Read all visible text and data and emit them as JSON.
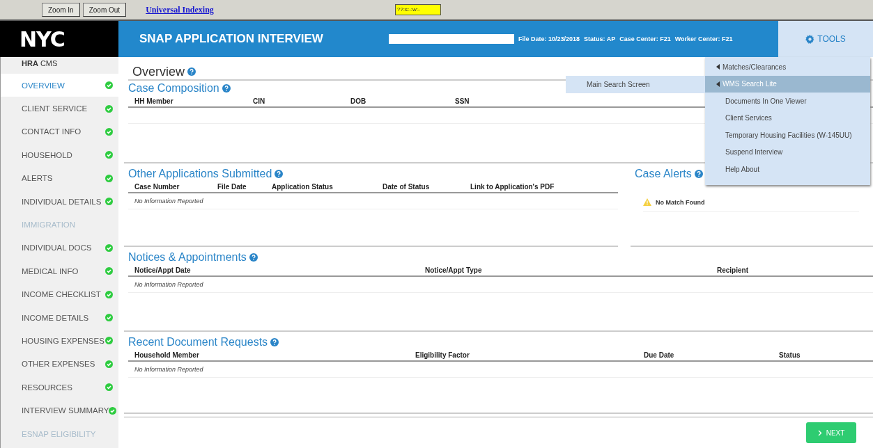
{
  "toolbar": {
    "buttons": [
      "Zoom In",
      "Zoom Out"
    ],
    "link": "Universal Indexing",
    "status_field": "??:s:-:w:-"
  },
  "header": {
    "logo": "NYC",
    "title": "SNAP APPLICATION INTERVIEW",
    "info": [
      "File Date: 10/23/2018",
      "Status: AP",
      "Case Center: F21",
      "Worker Center: F21"
    ],
    "tools": "TOOLS"
  },
  "sidebar": {
    "brand_bold": "HRA",
    "brand": "CMS",
    "items": [
      {
        "label": "OVERVIEW",
        "selected": true,
        "complete": true,
        "disabled": false
      },
      {
        "label": "CLIENT SERVICE",
        "selected": false,
        "complete": true,
        "disabled": false
      },
      {
        "label": "CONTACT INFO",
        "selected": false,
        "complete": true,
        "disabled": false
      },
      {
        "label": "HOUSEHOLD",
        "selected": false,
        "complete": true,
        "disabled": false
      },
      {
        "label": "ALERTS",
        "selected": false,
        "complete": true,
        "disabled": false
      },
      {
        "label": "INDIVIDUAL DETAILS",
        "selected": false,
        "complete": true,
        "disabled": false
      },
      {
        "label": "IMMIGRATION",
        "selected": false,
        "complete": false,
        "disabled": true
      },
      {
        "label": "INDIVIDUAL DOCS",
        "selected": false,
        "complete": true,
        "disabled": false
      },
      {
        "label": "MEDICAL INFO",
        "selected": false,
        "complete": true,
        "disabled": false
      },
      {
        "label": "INCOME CHECKLIST",
        "selected": false,
        "complete": true,
        "disabled": false
      },
      {
        "label": "INCOME DETAILS",
        "selected": false,
        "complete": true,
        "disabled": false
      },
      {
        "label": "HOUSING EXPENSES",
        "selected": false,
        "complete": true,
        "disabled": false
      },
      {
        "label": "OTHER EXPENSES",
        "selected": false,
        "complete": true,
        "disabled": false
      },
      {
        "label": "RESOURCES",
        "selected": false,
        "complete": true,
        "disabled": false
      },
      {
        "label": "INTERVIEW SUMMARY",
        "selected": false,
        "complete": true,
        "disabled": false
      },
      {
        "label": "ESNAP ELIGIBILITY",
        "selected": false,
        "complete": false,
        "disabled": true
      }
    ]
  },
  "page_title": "Overview",
  "sections": [
    {
      "title": "Case Composition",
      "columns": [
        "HH Member",
        "CIN",
        "DOB",
        "SSN"
      ]
    },
    {
      "title": "Other Applications Submitted",
      "columns": [
        "Case Number",
        "File Date",
        "Application Status",
        "Date of Status",
        "Link to Application's PDF"
      ],
      "empty": "No Information Reported",
      "side": {
        "title": "Case Alerts",
        "alert": "No Match Found"
      }
    },
    {
      "title": "Notices & Appointments",
      "columns": [
        "Notice/Appt Date",
        "Notice/Appt Type",
        "Recipient"
      ],
      "empty": "No Information Reported"
    },
    {
      "title": "Recent Document Requests",
      "columns": [
        "Household Member",
        "Eligibility Factor",
        "Due Date",
        "Status"
      ],
      "empty": "No Information Reported"
    }
  ],
  "tools_menu": [
    {
      "label": "Matches/Clearances",
      "submenu": true,
      "selected": false
    },
    {
      "label": "WMS Search Lite",
      "submenu": true,
      "selected": true,
      "children": [
        {
          "label": "Main Search Screen"
        }
      ]
    },
    {
      "label": "Documents In One Viewer",
      "submenu": false,
      "selected": false
    },
    {
      "label": "Client Services",
      "submenu": false,
      "selected": false
    },
    {
      "label": "Temporary Housing Facilities (W-145UU)",
      "submenu": false,
      "selected": false
    },
    {
      "label": "Suspend Interview",
      "submenu": false,
      "selected": false
    },
    {
      "label": "Help About",
      "submenu": false,
      "selected": false
    }
  ],
  "footer": {
    "next": "NEXT"
  }
}
